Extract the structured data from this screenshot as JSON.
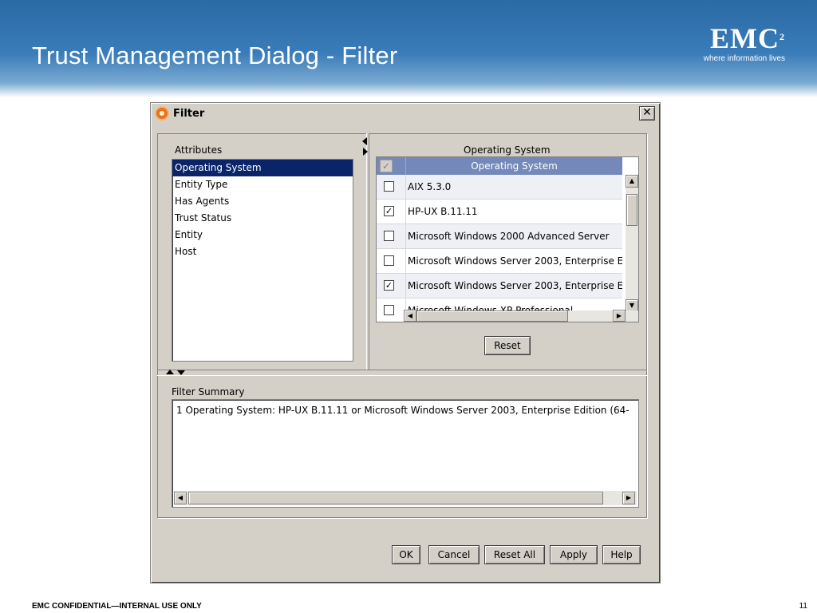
{
  "slide": {
    "title": "Trust Management Dialog - Filter",
    "logo_mark": "EMC",
    "logo_superscript": "2",
    "logo_tagline": "where information lives",
    "footer": "EMC CONFIDENTIAL—INTERNAL USE ONLY",
    "page_number": "11"
  },
  "dialog": {
    "title": "Filter",
    "close_glyph": "✕",
    "attributes": {
      "label": "Attributes",
      "items": [
        {
          "label": "Operating System",
          "selected": true
        },
        {
          "label": "Entity Type",
          "selected": false
        },
        {
          "label": "Has Agents",
          "selected": false
        },
        {
          "label": "Trust Status",
          "selected": false
        },
        {
          "label": "Entity",
          "selected": false
        },
        {
          "label": "Host",
          "selected": false
        }
      ]
    },
    "os_panel": {
      "label": "Operating System",
      "header_label": "Operating System",
      "header_check_glyph": "✓",
      "rows": [
        {
          "label": "AIX 5.3.0",
          "checked": false
        },
        {
          "label": "HP-UX B.11.11",
          "checked": true
        },
        {
          "label": "Microsoft Windows 2000 Advanced Server",
          "checked": false
        },
        {
          "label": "Microsoft Windows Server 2003, Enterprise E",
          "checked": false
        },
        {
          "label": "Microsoft Windows Server 2003, Enterprise E",
          "checked": true
        },
        {
          "label": "Microsoft Windows XP Professional",
          "checked": false
        }
      ],
      "check_glyph": "✓",
      "reset_label": "Reset"
    },
    "summary": {
      "label": "Filter Summary",
      "text": "1 Operating System:  HP-UX B.11.11 or Microsoft Windows Server 2003, Enterprise Edition (64-"
    },
    "buttons": {
      "ok": "OK",
      "cancel": "Cancel",
      "reset_all": "Reset All",
      "apply": "Apply",
      "help": "Help"
    },
    "scroll_glyphs": {
      "up": "▲",
      "down": "▼",
      "left": "◀",
      "right": "▶"
    }
  }
}
